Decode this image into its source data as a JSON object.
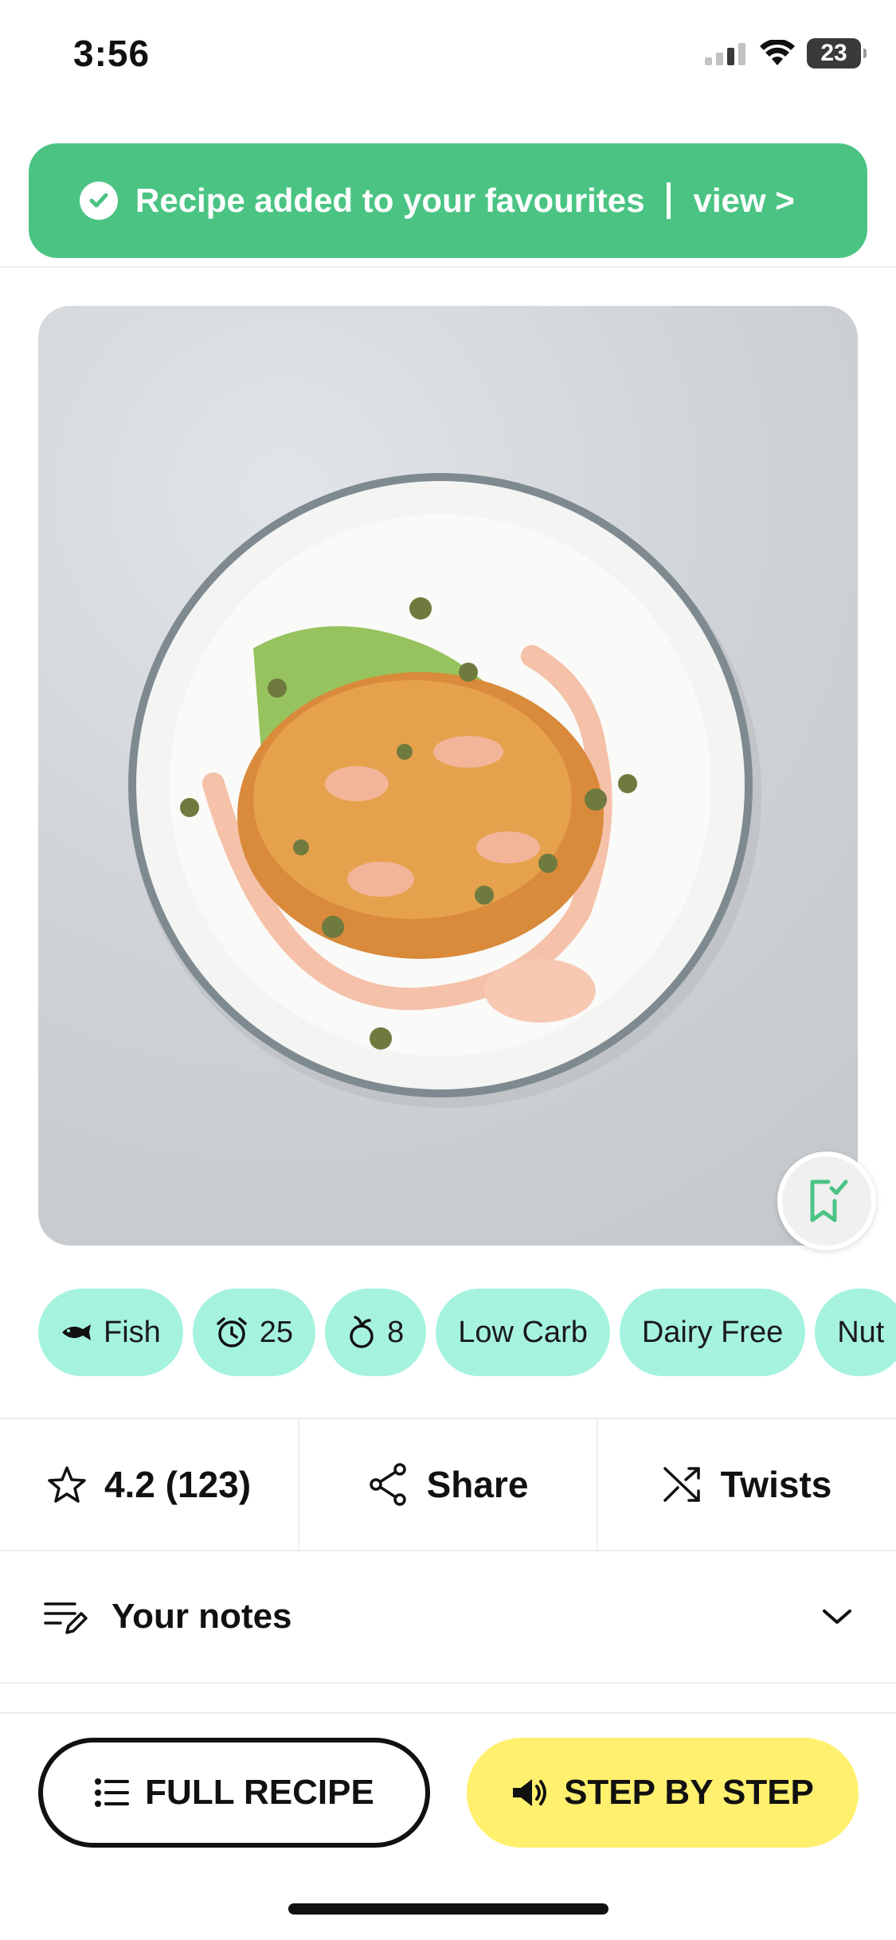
{
  "status_bar": {
    "time": "3:56",
    "battery_level": "23",
    "icons": [
      "cellular-signal-icon",
      "wifi-icon",
      "battery-icon"
    ]
  },
  "toast": {
    "message": "Recipe added to your favourites",
    "link": "view >",
    "color": "#4bc483",
    "icon": "check-circle-icon"
  },
  "hero": {
    "bookmark_icon": "bookmark-check-icon",
    "bookmark_color": "#4bc483"
  },
  "tags": [
    {
      "icon": "fish-icon",
      "label": "Fish"
    },
    {
      "icon": "alarm-clock-icon",
      "label": "25"
    },
    {
      "icon": "ingredients-count-icon",
      "label": "8"
    },
    {
      "icon": "",
      "label": "Low Carb"
    },
    {
      "icon": "",
      "label": "Dairy Free"
    },
    {
      "icon": "",
      "label": "Nut"
    }
  ],
  "tag_color": "#a5f3df",
  "actions": {
    "rating": "4.2 (123)",
    "share": "Share",
    "twists": "Twists"
  },
  "notes": {
    "label": "Your notes"
  },
  "bottom": {
    "full_recipe": "FULL RECIPE",
    "step_by_step": "STEP BY STEP",
    "step_color": "#fff06e"
  }
}
